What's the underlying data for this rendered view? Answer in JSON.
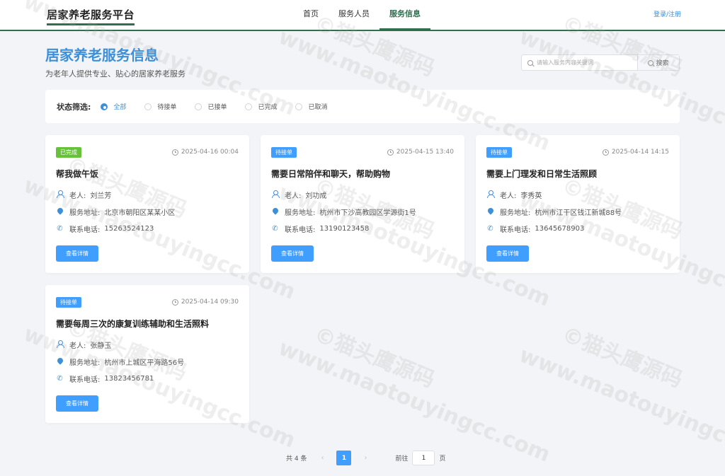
{
  "header": {
    "logo": "居家养老服务平台",
    "nav": [
      {
        "label": "首页",
        "active": false
      },
      {
        "label": "服务人员",
        "active": false
      },
      {
        "label": "服务信息",
        "active": true
      }
    ],
    "login": "登录/注册"
  },
  "page": {
    "title": "居家养老服务信息",
    "subtitle": "为老年人提供专业、贴心的居家养老服务"
  },
  "search": {
    "placeholder": "请输入服务内容关键词",
    "button": "搜索"
  },
  "filter": {
    "label": "状态筛选:",
    "options": [
      {
        "label": "全部",
        "checked": true
      },
      {
        "label": "待接单",
        "checked": false
      },
      {
        "label": "已接单",
        "checked": false
      },
      {
        "label": "已完成",
        "checked": false
      },
      {
        "label": "已取消",
        "checked": false
      }
    ]
  },
  "labels": {
    "elder": "老人:",
    "address": "服务地址:",
    "phone": "联系电话:",
    "detail": "查看详情"
  },
  "cards": [
    {
      "status": "已完成",
      "status_type": "done",
      "time": "2025-04-16 00:04",
      "title": "帮我做午饭",
      "elder": "刘兰芳",
      "address": "北京市朝阳区某某小区",
      "phone": "15263524123"
    },
    {
      "status": "待接单",
      "status_type": "pending",
      "time": "2025-04-15 13:40",
      "title": "需要日常陪伴和聊天，帮助购物",
      "elder": "刘功成",
      "address": "杭州市下沙高教园区学源街1号",
      "phone": "13190123458"
    },
    {
      "status": "待接单",
      "status_type": "pending",
      "time": "2025-04-14 14:15",
      "title": "需要上门理发和日常生活照顾",
      "elder": "李秀英",
      "address": "杭州市江干区钱江新城88号",
      "phone": "13645678903"
    },
    {
      "status": "待接单",
      "status_type": "pending",
      "time": "2025-04-14 09:30",
      "title": "需要每周三次的康复训练辅助和生活照料",
      "elder": "张静玉",
      "address": "杭州市上城区平海路56号",
      "phone": "13823456781"
    }
  ],
  "pagination": {
    "total": "共 4 条",
    "current": "1",
    "goto_label": "前往",
    "goto_value": "1",
    "page_suffix": "页"
  },
  "watermark": {
    "text_cn": "©猫头鹰源码",
    "text_url": "www.maotouyingcc.com"
  },
  "colors": {
    "brand": "#2f6f4e",
    "accent": "#409eff",
    "done": "#67c23a"
  }
}
